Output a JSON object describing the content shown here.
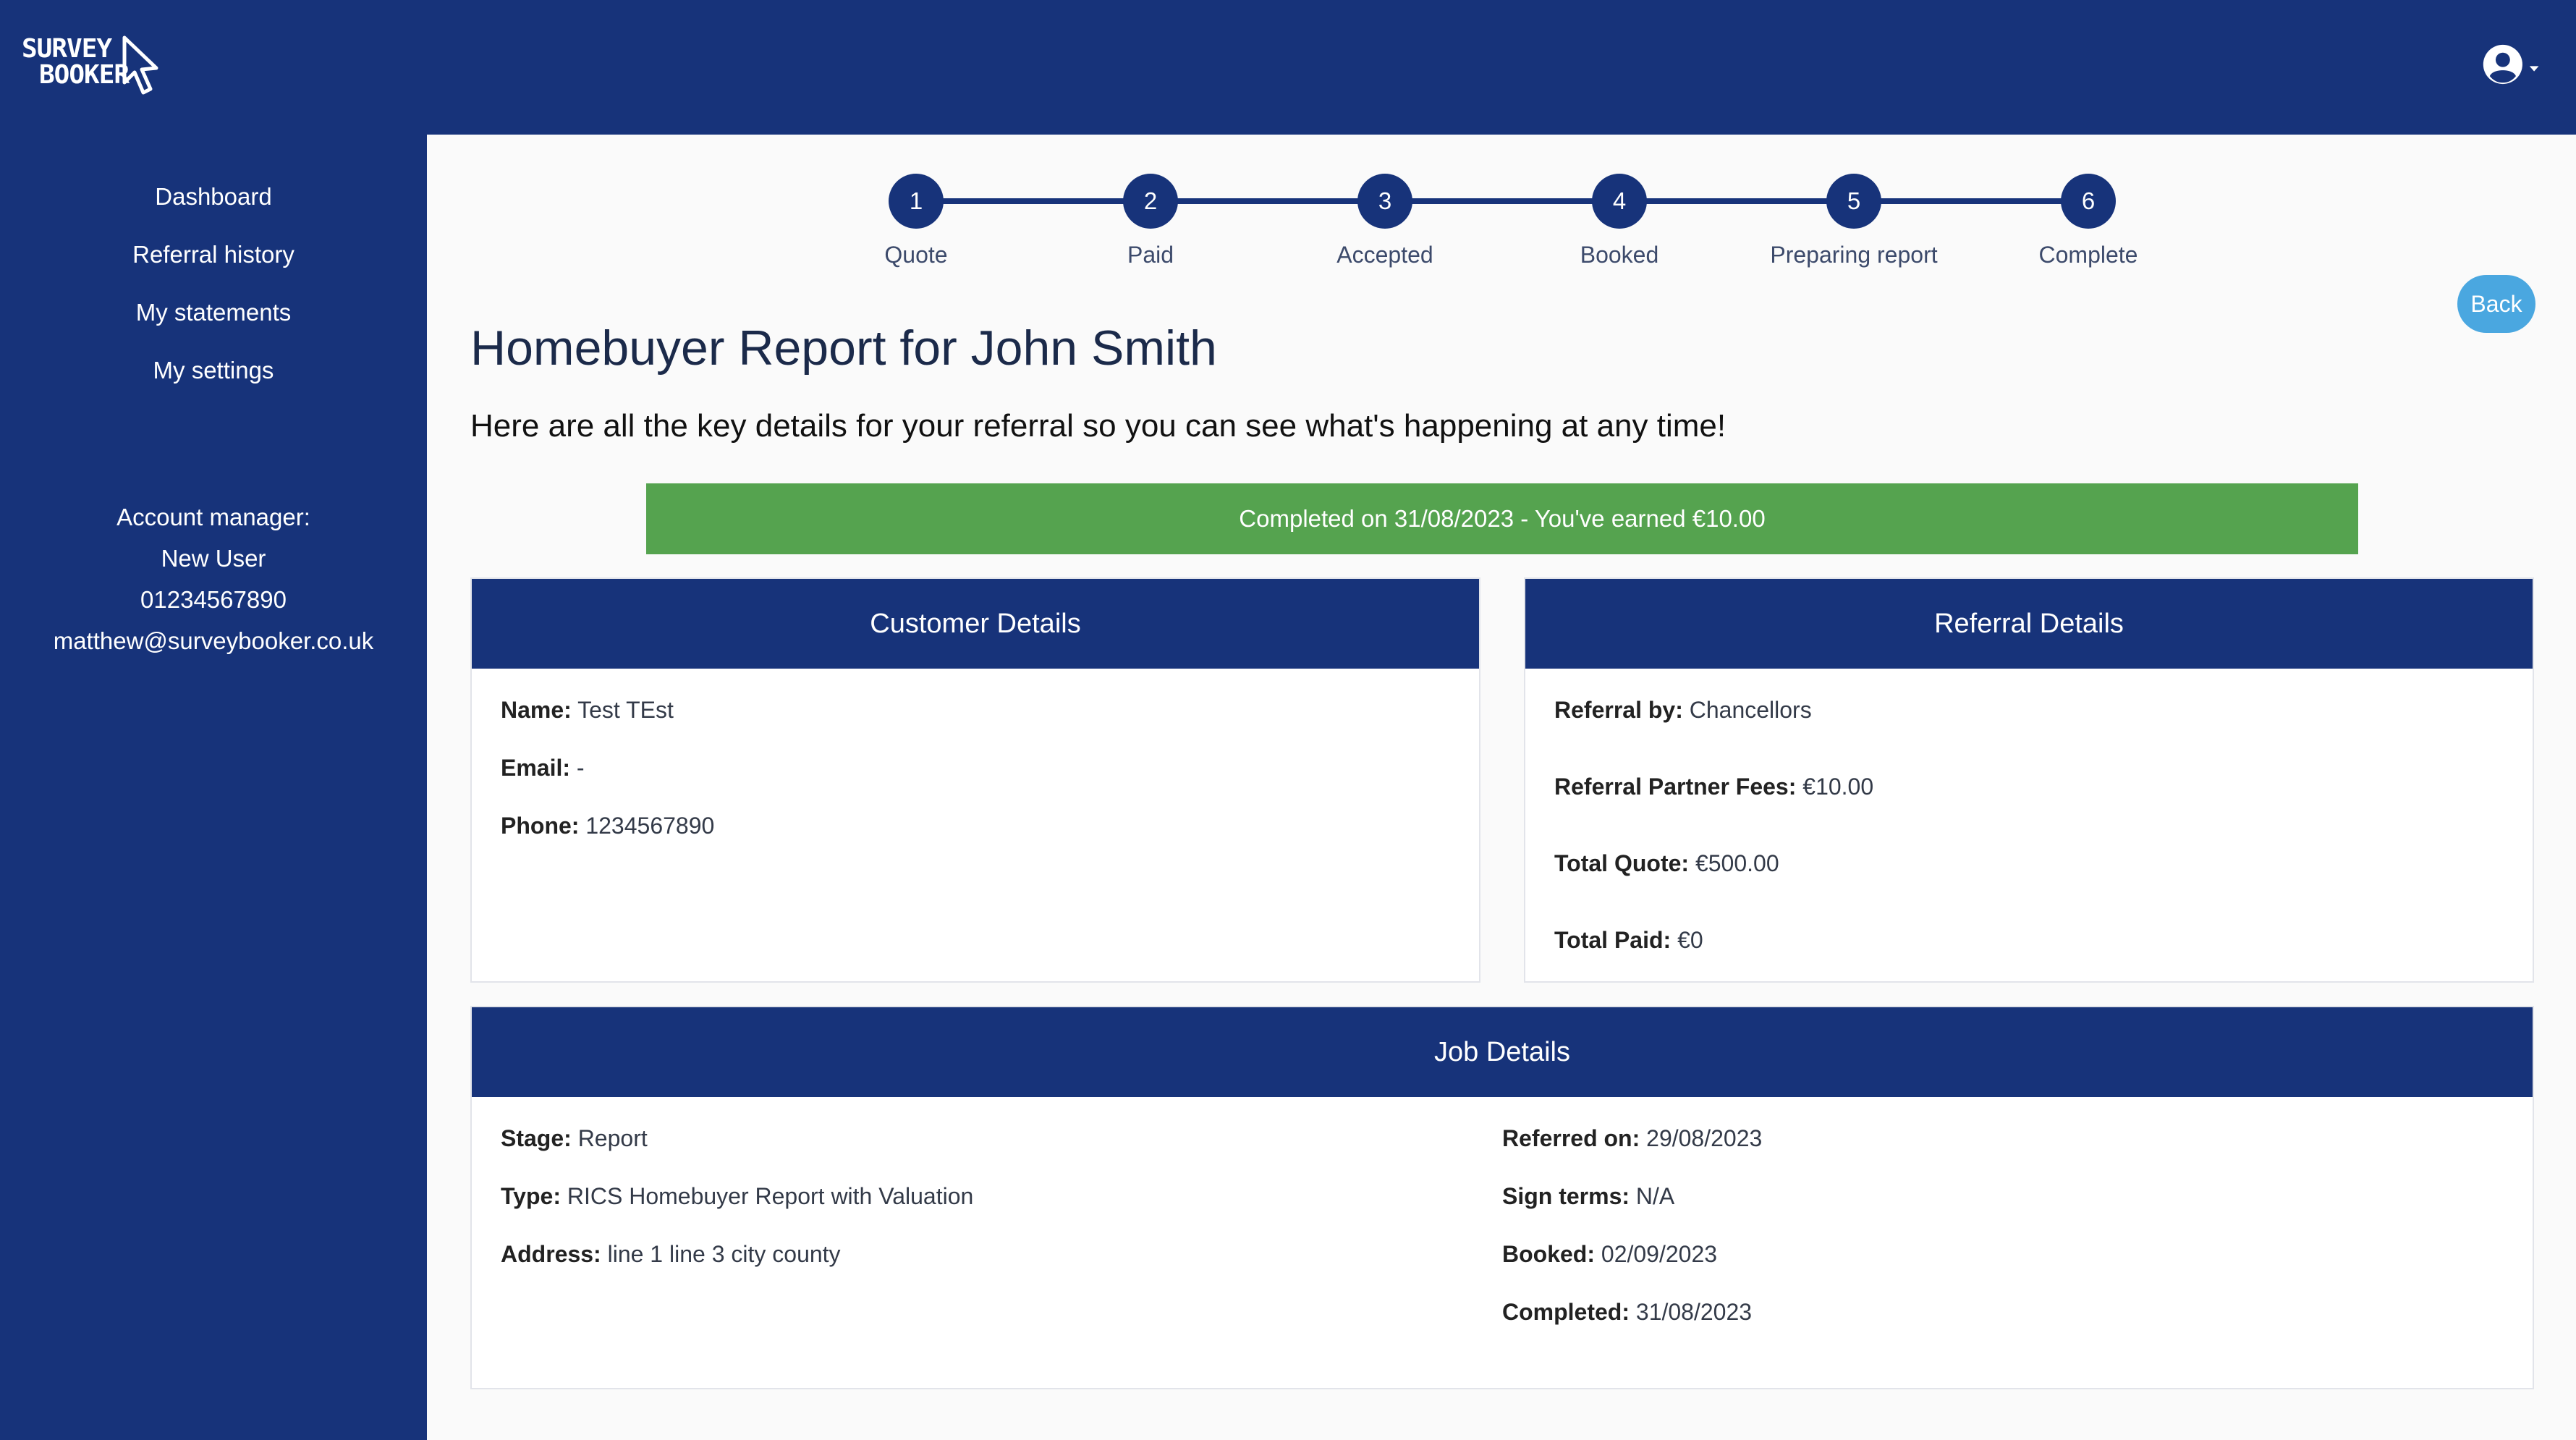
{
  "brand": {
    "line1": "SURVEY",
    "line2": "BOOKER"
  },
  "sidebar": {
    "nav": [
      "Dashboard",
      "Referral history",
      "My statements",
      "My settings"
    ],
    "account_label": "Account manager:",
    "account_name": "New User",
    "account_phone": "01234567890",
    "account_email": "matthew@surveybooker.co.uk"
  },
  "steps": [
    {
      "num": "1",
      "label": "Quote"
    },
    {
      "num": "2",
      "label": "Paid"
    },
    {
      "num": "3",
      "label": "Accepted"
    },
    {
      "num": "4",
      "label": "Booked"
    },
    {
      "num": "5",
      "label": "Preparing report"
    },
    {
      "num": "6",
      "label": "Complete"
    }
  ],
  "back_label": "Back",
  "title": "Homebuyer Report for John Smith",
  "subtitle": "Here are all the key details for your referral so you can see what's happening at any time!",
  "status_banner": "Completed on 31/08/2023 - You've earned €10.00",
  "customer": {
    "heading": "Customer Details",
    "name_label": "Name:",
    "name": "Test TEst",
    "email_label": "Email:",
    "email": "-",
    "phone_label": "Phone:",
    "phone": "1234567890"
  },
  "referral": {
    "heading": "Referral Details",
    "by_label": "Referral by:",
    "by": "Chancellors",
    "fees_label": "Referral Partner Fees:",
    "fees": "€10.00",
    "quote_label": "Total Quote:",
    "quote": "€500.00",
    "paid_label": "Total Paid:",
    "paid": "€0"
  },
  "job": {
    "heading": "Job Details",
    "stage_label": "Stage:",
    "stage": "Report",
    "type_label": "Type:",
    "type": "RICS Homebuyer Report with Valuation",
    "address_label": "Address:",
    "address": "line 1 line 3 city county",
    "referred_label": "Referred on:",
    "referred": "29/08/2023",
    "terms_label": "Sign terms:",
    "terms": "N/A",
    "booked_label": "Booked:",
    "booked": "02/09/2023",
    "completed_label": "Completed:",
    "completed": "31/08/2023"
  },
  "colors": {
    "navy": "#17337a",
    "success": "#55a34f",
    "accent": "#4aa7e0"
  }
}
